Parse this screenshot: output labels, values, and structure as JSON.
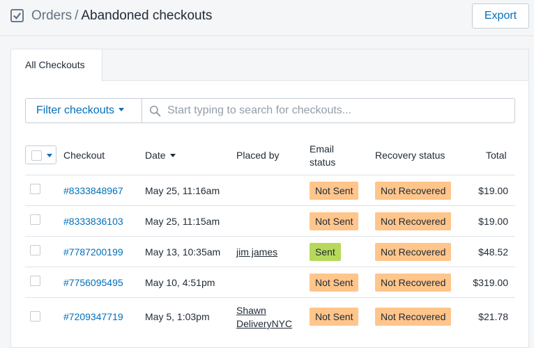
{
  "header": {
    "breadcrumb_parent": "Orders",
    "breadcrumb_separator": "/",
    "title": "Abandoned checkouts",
    "export_label": "Export",
    "icon": "checkbox-icon"
  },
  "tabs": [
    {
      "label": "All Checkouts",
      "active": true
    }
  ],
  "filter": {
    "button_label": "Filter checkouts",
    "search_placeholder": "Start typing to search for checkouts..."
  },
  "table": {
    "columns": {
      "checkout": "Checkout",
      "date": "Date",
      "placed_by": "Placed by",
      "email_status_line1": "Email",
      "email_status_line2": "status",
      "recovery_status": "Recovery status",
      "total": "Total"
    },
    "rows": [
      {
        "checkout": "#8333848967",
        "date": "May 25, 11:16am",
        "placed_by": "",
        "email_status": "Not Sent",
        "recovery_status": "Not Recovered",
        "total": "$19.00"
      },
      {
        "checkout": "#8333836103",
        "date": "May 25, 11:15am",
        "placed_by": "",
        "email_status": "Not Sent",
        "recovery_status": "Not Recovered",
        "total": "$19.00"
      },
      {
        "checkout": "#7787200199",
        "date": "May 13, 10:35am",
        "placed_by": "jim james",
        "email_status": "Sent",
        "recovery_status": "Not Recovered",
        "total": "$48.52"
      },
      {
        "checkout": "#7756095495",
        "date": "May 10, 4:51pm",
        "placed_by": "",
        "email_status": "Not Sent",
        "recovery_status": "Not Recovered",
        "total": "$319.00"
      },
      {
        "checkout": "#7209347719",
        "date": "May 5, 1:03pm",
        "placed_by": "Shawn DeliveryNYC",
        "email_status": "Not Sent",
        "recovery_status": "Not Recovered",
        "total": "$21.78"
      }
    ]
  },
  "colors": {
    "link": "#006fbb",
    "badge_warning": "#ffc58b",
    "badge_success": "#b7d95b",
    "border": "#dfe3e8"
  }
}
